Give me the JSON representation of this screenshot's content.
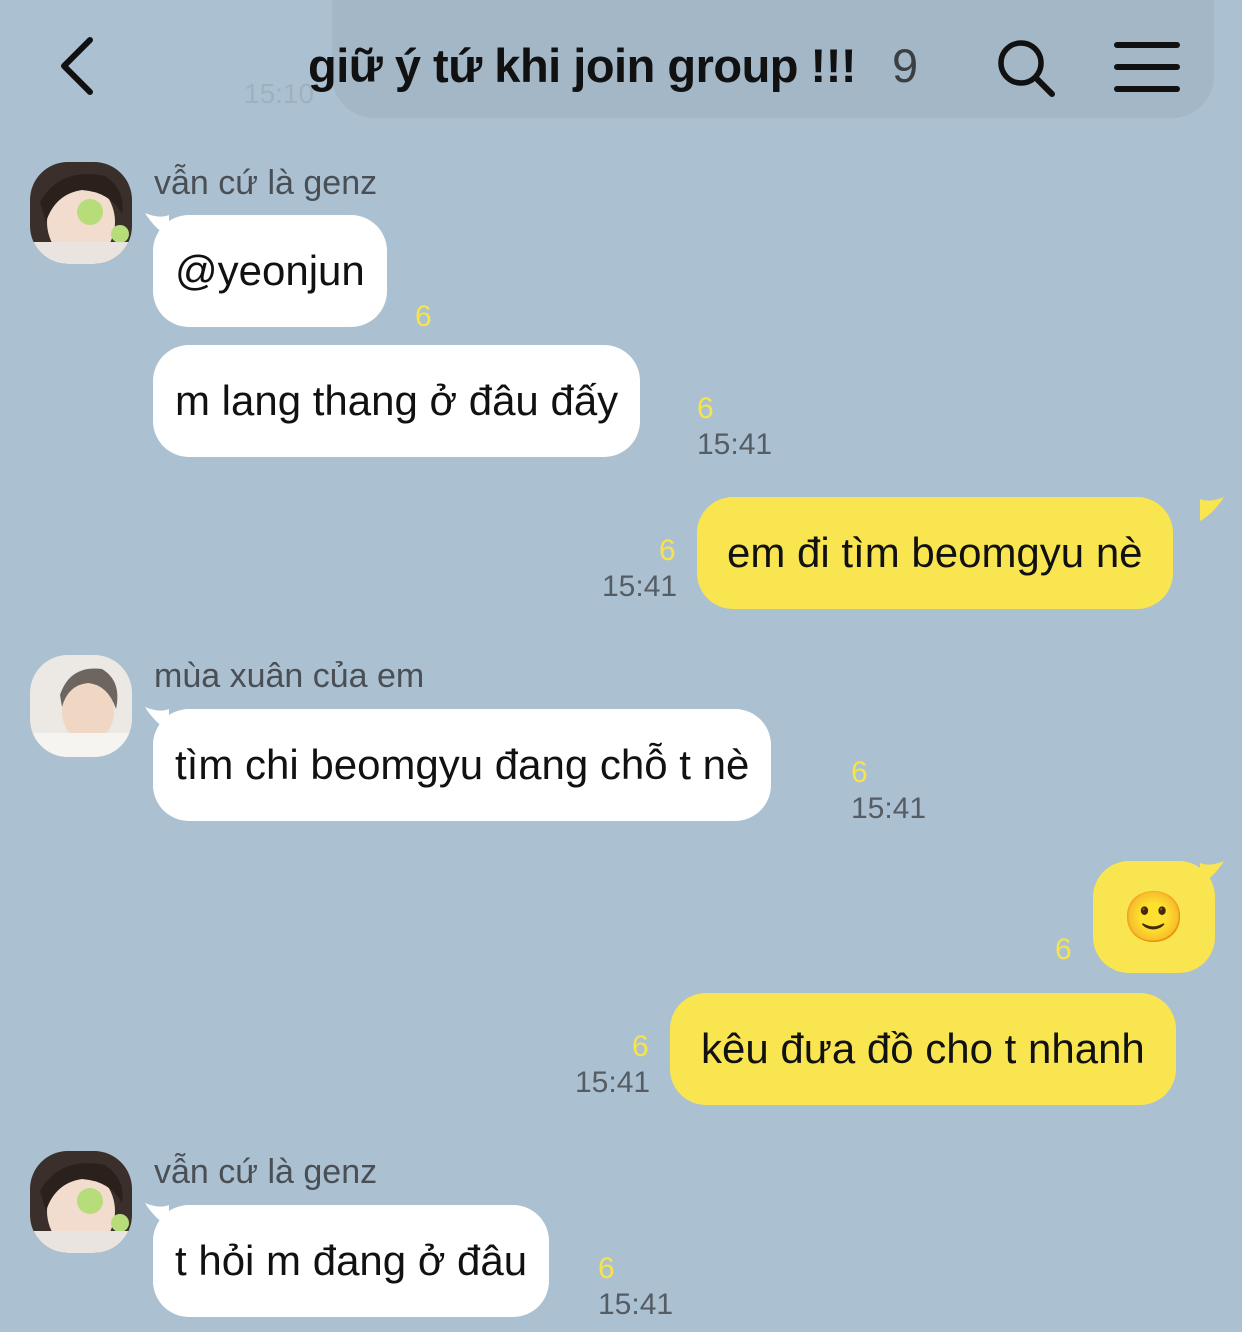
{
  "header": {
    "title": "giữ ý tứ khi join group !!!",
    "member_count": "9",
    "ghost_time": "15:10"
  },
  "messages": [
    {
      "sender": "vẫn cứ là genz",
      "text": "@yeonjun",
      "unread": "6",
      "time": ""
    },
    {
      "text": "m lang thang ở đâu đấy",
      "unread": "6",
      "time": "15:41"
    },
    {
      "text": "em đi tìm beomgyu nè",
      "unread": "6",
      "time": "15:41"
    },
    {
      "sender": "mùa xuân của em",
      "text": "tìm chi beomgyu đang chỗ t nè",
      "unread": "6",
      "time": "15:41"
    },
    {
      "text": "🙂",
      "unread": "6",
      "time": ""
    },
    {
      "text": "kêu đưa đồ cho t nhanh",
      "unread": "6",
      "time": "15:41"
    },
    {
      "sender": "vẫn cứ là genz",
      "text": "t hỏi m đang ở đâu",
      "unread": "6",
      "time": "15:41"
    }
  ],
  "colors": {
    "background": "#abc1d1",
    "incoming_bubble": "#ffffff",
    "outgoing_bubble": "#f9e54f",
    "unread_count": "#f7e34a"
  },
  "icons": {
    "back": "chevron-left-icon",
    "search": "search-icon",
    "menu": "hamburger-menu-icon"
  }
}
